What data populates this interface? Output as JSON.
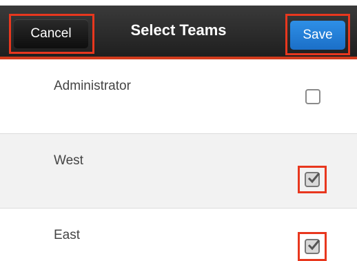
{
  "header": {
    "title": "Select Teams",
    "cancel_label": "Cancel",
    "save_label": "Save"
  },
  "teams": [
    {
      "label": "Administrator",
      "checked": false
    },
    {
      "label": "West",
      "checked": true
    },
    {
      "label": "East",
      "checked": true
    }
  ],
  "colors": {
    "navbar": "#2b2b2b",
    "save_button": "#2680d8",
    "highlight": "#e8371e"
  }
}
